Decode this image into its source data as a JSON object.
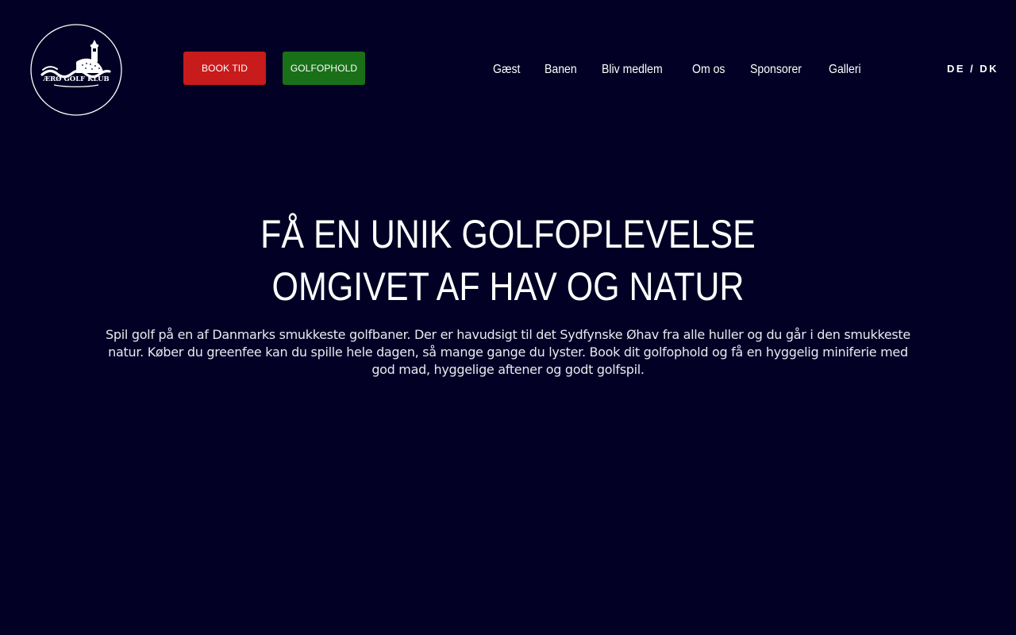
{
  "logo": {
    "text": "ÆRØ GOLF KLUB"
  },
  "cta": {
    "book": "BOOK TID",
    "stay": "GOLFOPHOLD"
  },
  "nav": {
    "items": [
      "Gæst",
      "Banen",
      "Bliv medlem",
      "Om os",
      "Sponsorer",
      "Galleri"
    ]
  },
  "lang": {
    "de": "DE",
    "sep": "/",
    "dk": "DK"
  },
  "hero": {
    "title_line1": "FÅ EN UNIK GOLFOPLEVELSE",
    "title_line2": "OMGIVET AF HAV OG NATUR",
    "text": "Spil golf på en af Danmarks smukkeste golfbaner. Der er havudsigt til det Sydfynske Øhav fra alle huller og du går i den smukkeste natur. Køber du greenfee kan du spille hele dagen, så mange gange du lyster. Book dit golfophold og få en hyggelig miniferie med god mad, hyggelige aftener og godt golfspil."
  },
  "colors": {
    "background": "#020024",
    "book_button": "#c81b1b",
    "stay_button": "#1a7018"
  }
}
